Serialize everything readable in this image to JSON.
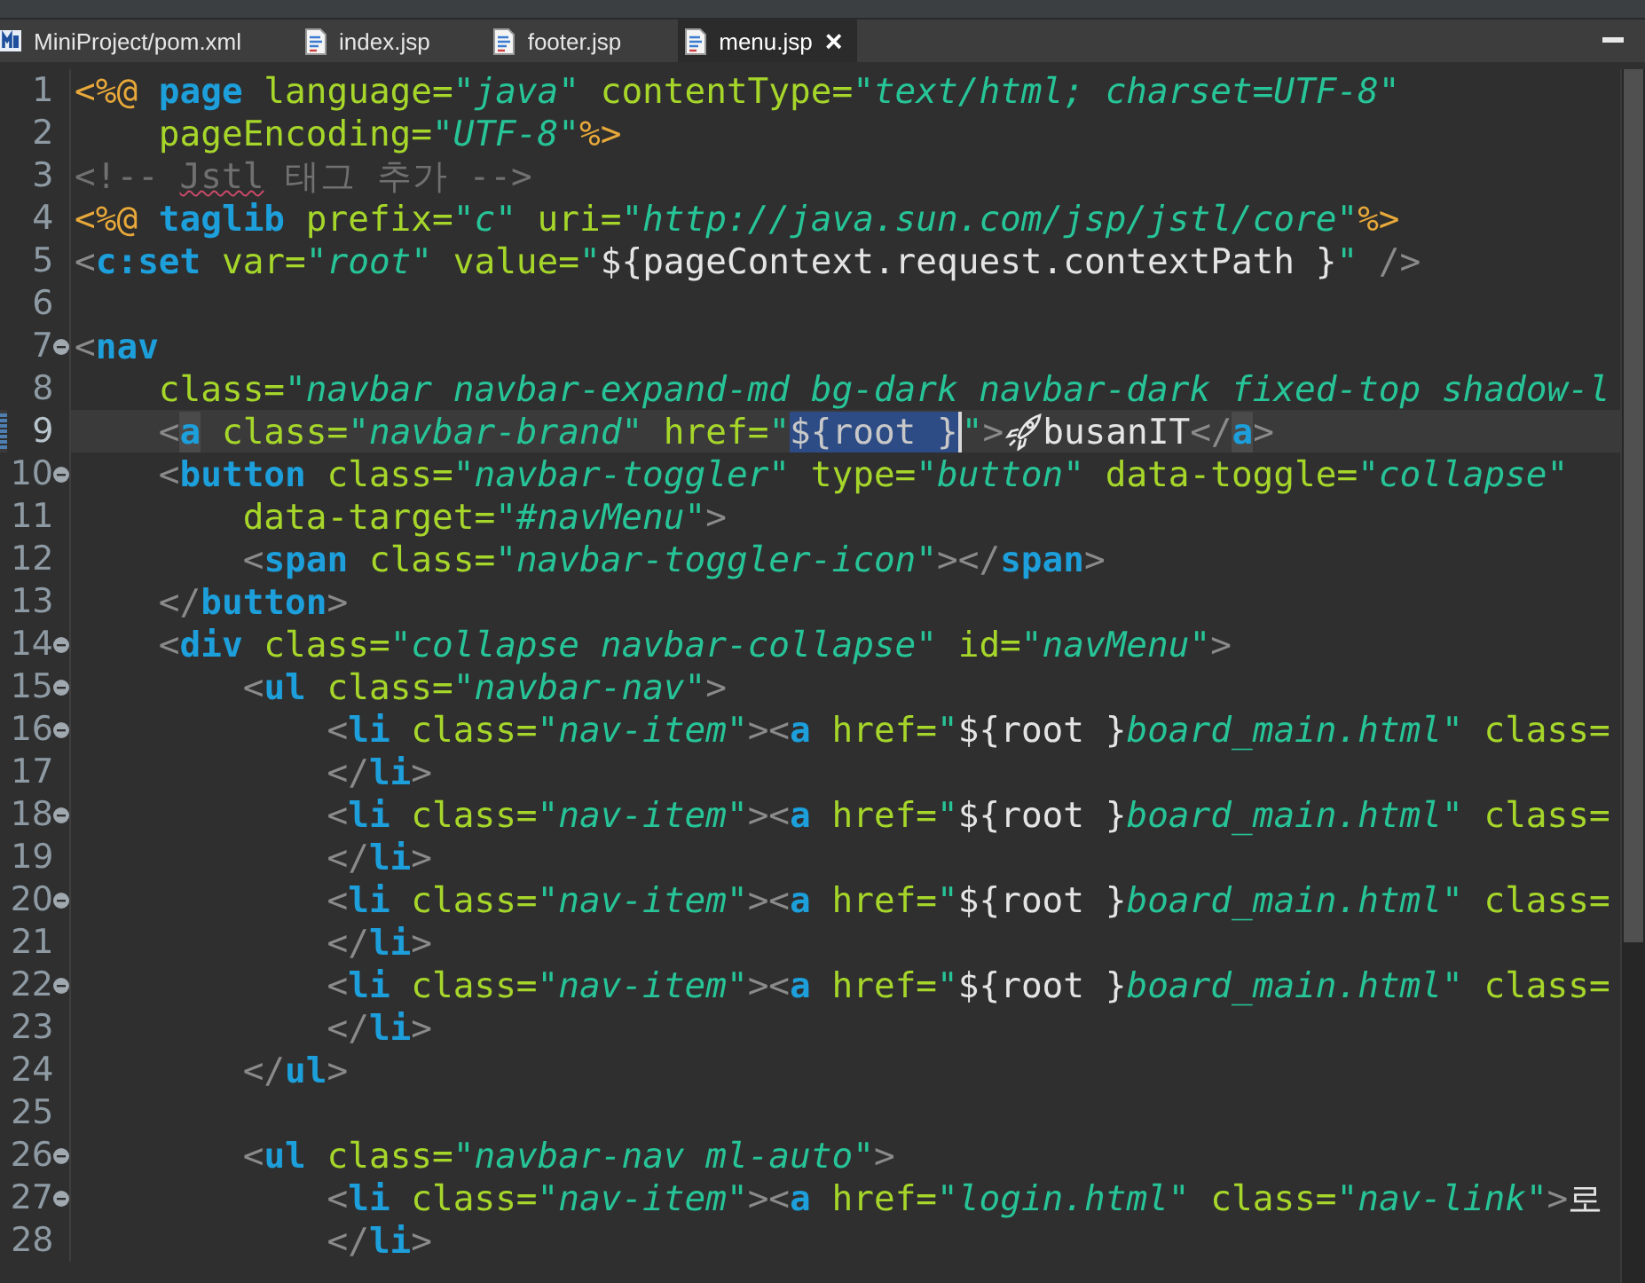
{
  "tabs": [
    {
      "label": "MiniProject/pom.xml",
      "kind": "maven",
      "selected": false
    },
    {
      "label": "index.jsp",
      "kind": "jsp",
      "selected": false
    },
    {
      "label": "footer.jsp",
      "kind": "jsp",
      "selected": false
    },
    {
      "label": "menu.jsp",
      "kind": "jsp",
      "selected": true,
      "close": "×"
    }
  ],
  "editor": {
    "lines": [
      {
        "number": "1",
        "foldable": false,
        "current": false,
        "tokens": [
          {
            "kind": "delim",
            "text": "<%@"
          },
          {
            "kind": "tag",
            "text": " page"
          },
          {
            "kind": "attr",
            "text": " language="
          },
          {
            "kind": "string",
            "text": "\"java\""
          },
          {
            "kind": "attr",
            "text": " contentType="
          },
          {
            "kind": "string",
            "text": "\"text/html; charset=UTF-8\""
          }
        ]
      },
      {
        "number": "2",
        "foldable": false,
        "current": false,
        "tokens": [
          {
            "kind": "attr",
            "text": "    pageEncoding="
          },
          {
            "kind": "string",
            "text": "\"UTF-8\""
          },
          {
            "kind": "delim",
            "text": "%>"
          }
        ]
      },
      {
        "number": "3",
        "foldable": false,
        "current": false,
        "tokens": [
          {
            "kind": "comment",
            "text": "<!-- "
          },
          {
            "kind": "typo",
            "text": "Jstl"
          },
          {
            "kind": "comment",
            "text": " 태그 추가 -->"
          }
        ]
      },
      {
        "number": "4",
        "foldable": false,
        "current": false,
        "tokens": [
          {
            "kind": "delim",
            "text": "<%@"
          },
          {
            "kind": "tag",
            "text": " taglib"
          },
          {
            "kind": "attr",
            "text": " prefix="
          },
          {
            "kind": "string",
            "text": "\"c\""
          },
          {
            "kind": "attr",
            "text": " uri="
          },
          {
            "kind": "string",
            "text": "\"http://java.sun.com/jsp/jstl/core\""
          },
          {
            "kind": "delim",
            "text": "%>"
          }
        ]
      },
      {
        "number": "5",
        "foldable": false,
        "current": false,
        "tokens": [
          {
            "kind": "punct",
            "text": "<"
          },
          {
            "kind": "tag",
            "text": "c:set"
          },
          {
            "kind": "attr",
            "text": " var="
          },
          {
            "kind": "string",
            "text": "\"root\""
          },
          {
            "kind": "attr",
            "text": " value="
          },
          {
            "kind": "string",
            "text": "\""
          },
          {
            "kind": "plain",
            "text": "${pageContext.request.contextPath }"
          },
          {
            "kind": "string",
            "text": "\""
          },
          {
            "kind": "punct",
            "text": " />"
          }
        ]
      },
      {
        "number": "6",
        "foldable": false,
        "current": false
      },
      {
        "number": "7",
        "foldable": true,
        "current": false,
        "tokens": [
          {
            "kind": "punct",
            "text": "<"
          },
          {
            "kind": "tag",
            "text": "nav"
          }
        ]
      },
      {
        "number": "8",
        "foldable": false,
        "current": false,
        "tokens": [
          {
            "kind": "attr",
            "text": "    class="
          },
          {
            "kind": "string",
            "text": "\"navbar navbar-expand-md bg-dark navbar-dark fixed-top shadow-l"
          }
        ]
      },
      {
        "number": "9",
        "foldable": false,
        "current": true,
        "tokens": [
          {
            "kind": "punct",
            "text": "    <"
          },
          {
            "kind": "occurrence",
            "text": "a"
          },
          {
            "kind": "attr",
            "text": " class="
          },
          {
            "kind": "string",
            "text": "\"navbar-brand\""
          },
          {
            "kind": "attr",
            "text": " href="
          },
          {
            "kind": "string",
            "text": "\""
          },
          {
            "kind": "selection",
            "text": "${root }"
          },
          {
            "kind": "string",
            "text": "\""
          },
          {
            "kind": "punct",
            "text": ">"
          },
          {
            "kind": "icon"
          },
          {
            "kind": "plain",
            "text": "busanIT"
          },
          {
            "kind": "punct",
            "text": "</"
          },
          {
            "kind": "occurrence",
            "text": "a"
          },
          {
            "kind": "punct",
            "text": ">"
          }
        ]
      },
      {
        "number": "10",
        "foldable": true,
        "current": false,
        "tokens": [
          {
            "kind": "punct",
            "text": "    <"
          },
          {
            "kind": "tag",
            "text": "button"
          },
          {
            "kind": "attr",
            "text": " class="
          },
          {
            "kind": "string",
            "text": "\"navbar-toggler\""
          },
          {
            "kind": "attr",
            "text": " type="
          },
          {
            "kind": "string",
            "text": "\"button\""
          },
          {
            "kind": "attr",
            "text": " data-toggle="
          },
          {
            "kind": "string",
            "text": "\"collapse\""
          }
        ]
      },
      {
        "number": "11",
        "foldable": false,
        "current": false,
        "tokens": [
          {
            "kind": "attr",
            "text": "        data-target="
          },
          {
            "kind": "string",
            "text": "\"#navMenu\""
          },
          {
            "kind": "punct",
            "text": ">"
          }
        ]
      },
      {
        "number": "12",
        "foldable": false,
        "current": false,
        "tokens": [
          {
            "kind": "punct",
            "text": "        <"
          },
          {
            "kind": "tag",
            "text": "span"
          },
          {
            "kind": "attr",
            "text": " class="
          },
          {
            "kind": "string",
            "text": "\"navbar-toggler-icon\""
          },
          {
            "kind": "punct",
            "text": "></"
          },
          {
            "kind": "tag",
            "text": "span"
          },
          {
            "kind": "punct",
            "text": ">"
          }
        ]
      },
      {
        "number": "13",
        "foldable": false,
        "current": false,
        "tokens": [
          {
            "kind": "punct",
            "text": "    </"
          },
          {
            "kind": "tag",
            "text": "button"
          },
          {
            "kind": "punct",
            "text": ">"
          }
        ]
      },
      {
        "number": "14",
        "foldable": true,
        "current": false,
        "tokens": [
          {
            "kind": "punct",
            "text": "    <"
          },
          {
            "kind": "tag",
            "text": "div"
          },
          {
            "kind": "attr",
            "text": " class="
          },
          {
            "kind": "string",
            "text": "\"collapse navbar-collapse\""
          },
          {
            "kind": "attr",
            "text": " id="
          },
          {
            "kind": "string",
            "text": "\"navMenu\""
          },
          {
            "kind": "punct",
            "text": ">"
          }
        ]
      },
      {
        "number": "15",
        "foldable": true,
        "current": false,
        "tokens": [
          {
            "kind": "punct",
            "text": "        <"
          },
          {
            "kind": "tag",
            "text": "ul"
          },
          {
            "kind": "attr",
            "text": " class="
          },
          {
            "kind": "string",
            "text": "\"navbar-nav\""
          },
          {
            "kind": "punct",
            "text": ">"
          }
        ]
      },
      {
        "number": "16",
        "foldable": true,
        "current": false,
        "tokens": [
          {
            "kind": "punct",
            "text": "            <"
          },
          {
            "kind": "tag",
            "text": "li"
          },
          {
            "kind": "attr",
            "text": " class="
          },
          {
            "kind": "string",
            "text": "\"nav-item\""
          },
          {
            "kind": "punct",
            "text": "><"
          },
          {
            "kind": "tag",
            "text": "a"
          },
          {
            "kind": "attr",
            "text": " href="
          },
          {
            "kind": "string",
            "text": "\""
          },
          {
            "kind": "plain",
            "text": "${root }"
          },
          {
            "kind": "string",
            "text": "board_main.html\""
          },
          {
            "kind": "attr",
            "text": " class="
          }
        ]
      },
      {
        "number": "17",
        "foldable": false,
        "current": false,
        "tokens": [
          {
            "kind": "punct",
            "text": "            </"
          },
          {
            "kind": "tag",
            "text": "li"
          },
          {
            "kind": "punct",
            "text": ">"
          }
        ]
      },
      {
        "number": "18",
        "foldable": true,
        "current": false,
        "tokens": [
          {
            "kind": "punct",
            "text": "            <"
          },
          {
            "kind": "tag",
            "text": "li"
          },
          {
            "kind": "attr",
            "text": " class="
          },
          {
            "kind": "string",
            "text": "\"nav-item\""
          },
          {
            "kind": "punct",
            "text": "><"
          },
          {
            "kind": "tag",
            "text": "a"
          },
          {
            "kind": "attr",
            "text": " href="
          },
          {
            "kind": "string",
            "text": "\""
          },
          {
            "kind": "plain",
            "text": "${root }"
          },
          {
            "kind": "string",
            "text": "board_main.html\""
          },
          {
            "kind": "attr",
            "text": " class="
          }
        ]
      },
      {
        "number": "19",
        "foldable": false,
        "current": false,
        "tokens": [
          {
            "kind": "punct",
            "text": "            </"
          },
          {
            "kind": "tag",
            "text": "li"
          },
          {
            "kind": "punct",
            "text": ">"
          }
        ]
      },
      {
        "number": "20",
        "foldable": true,
        "current": false,
        "tokens": [
          {
            "kind": "punct",
            "text": "            <"
          },
          {
            "kind": "tag",
            "text": "li"
          },
          {
            "kind": "attr",
            "text": " class="
          },
          {
            "kind": "string",
            "text": "\"nav-item\""
          },
          {
            "kind": "punct",
            "text": "><"
          },
          {
            "kind": "tag",
            "text": "a"
          },
          {
            "kind": "attr",
            "text": " href="
          },
          {
            "kind": "string",
            "text": "\""
          },
          {
            "kind": "plain",
            "text": "${root }"
          },
          {
            "kind": "string",
            "text": "board_main.html\""
          },
          {
            "kind": "attr",
            "text": " class="
          }
        ]
      },
      {
        "number": "21",
        "foldable": false,
        "current": false,
        "tokens": [
          {
            "kind": "punct",
            "text": "            </"
          },
          {
            "kind": "tag",
            "text": "li"
          },
          {
            "kind": "punct",
            "text": ">"
          }
        ]
      },
      {
        "number": "22",
        "foldable": true,
        "current": false,
        "tokens": [
          {
            "kind": "punct",
            "text": "            <"
          },
          {
            "kind": "tag",
            "text": "li"
          },
          {
            "kind": "attr",
            "text": " class="
          },
          {
            "kind": "string",
            "text": "\"nav-item\""
          },
          {
            "kind": "punct",
            "text": "><"
          },
          {
            "kind": "tag",
            "text": "a"
          },
          {
            "kind": "attr",
            "text": " href="
          },
          {
            "kind": "string",
            "text": "\""
          },
          {
            "kind": "plain",
            "text": "${root }"
          },
          {
            "kind": "string",
            "text": "board_main.html\""
          },
          {
            "kind": "attr",
            "text": " class="
          }
        ]
      },
      {
        "number": "23",
        "foldable": false,
        "current": false,
        "tokens": [
          {
            "kind": "punct",
            "text": "            </"
          },
          {
            "kind": "tag",
            "text": "li"
          },
          {
            "kind": "punct",
            "text": ">"
          }
        ]
      },
      {
        "number": "24",
        "foldable": false,
        "current": false,
        "tokens": [
          {
            "kind": "punct",
            "text": "        </"
          },
          {
            "kind": "tag",
            "text": "ul"
          },
          {
            "kind": "punct",
            "text": ">"
          }
        ]
      },
      {
        "number": "25",
        "foldable": false,
        "current": false
      },
      {
        "number": "26",
        "foldable": true,
        "current": false,
        "tokens": [
          {
            "kind": "punct",
            "text": "        <"
          },
          {
            "kind": "tag",
            "text": "ul"
          },
          {
            "kind": "attr",
            "text": " class="
          },
          {
            "kind": "string",
            "text": "\"navbar-nav ml-auto\""
          },
          {
            "kind": "punct",
            "text": ">"
          }
        ]
      },
      {
        "number": "27",
        "foldable": true,
        "current": false,
        "tokens": [
          {
            "kind": "punct",
            "text": "            <"
          },
          {
            "kind": "tag",
            "text": "li"
          },
          {
            "kind": "attr",
            "text": " class="
          },
          {
            "kind": "string",
            "text": "\"nav-item\""
          },
          {
            "kind": "punct",
            "text": "><"
          },
          {
            "kind": "tag",
            "text": "a"
          },
          {
            "kind": "attr",
            "text": " href="
          },
          {
            "kind": "string",
            "text": "\"login.html\""
          },
          {
            "kind": "attr",
            "text": " class="
          },
          {
            "kind": "string",
            "text": "\"nav-link\""
          },
          {
            "kind": "punct",
            "text": ">"
          },
          {
            "kind": "plain",
            "text": "로"
          }
        ]
      },
      {
        "number": "28",
        "foldable": false,
        "current": false,
        "tokens": [
          {
            "kind": "punct",
            "text": "            </"
          },
          {
            "kind": "tag",
            "text": "li"
          },
          {
            "kind": "punct",
            "text": ">"
          }
        ]
      }
    ]
  }
}
